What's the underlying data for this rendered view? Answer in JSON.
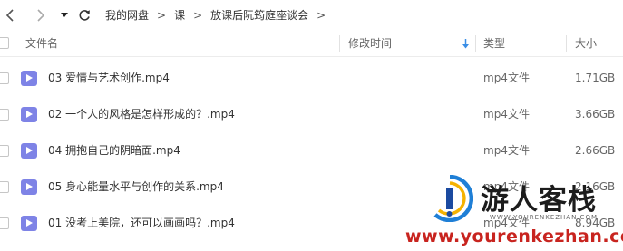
{
  "breadcrumb": [
    "我的网盘",
    "课",
    "放课后阮筠庭座谈会"
  ],
  "columns": {
    "name": "文件名",
    "modified": "修改时间",
    "type": "类型",
    "size": "大小"
  },
  "files": [
    {
      "name": "03 爱情与艺术创作.mp4",
      "type": "mp4文件",
      "size": "1.71GB"
    },
    {
      "name": "02 一个人的风格是怎样形成的？.mp4",
      "type": "mp4文件",
      "size": "3.66GB"
    },
    {
      "name": "04 拥抱自己的阴暗面.mp4",
      "type": "mp4文件",
      "size": "2.66GB"
    },
    {
      "name": "05 身心能量水平与创作的关系.mp4",
      "type": "mp4文件",
      "size": "2.16GB"
    },
    {
      "name": "01 没考上美院，还可以画画吗？.mp4",
      "type": "mp4文件",
      "size": "8.94GB"
    }
  ],
  "watermark": {
    "title": "游人客栈",
    "subtitle": "WWW.YOURENKEZHAN.COM",
    "url": "www.yourenkezhan.com"
  },
  "colors": {
    "file_icon": "#7e83e6",
    "sort_arrow": "#3a8ee6",
    "watermark_url": "#c8241f"
  },
  "icons": [
    "back-icon",
    "forward-icon",
    "dropdown-icon",
    "refresh-icon",
    "sort-down-icon",
    "video-file-icon"
  ]
}
